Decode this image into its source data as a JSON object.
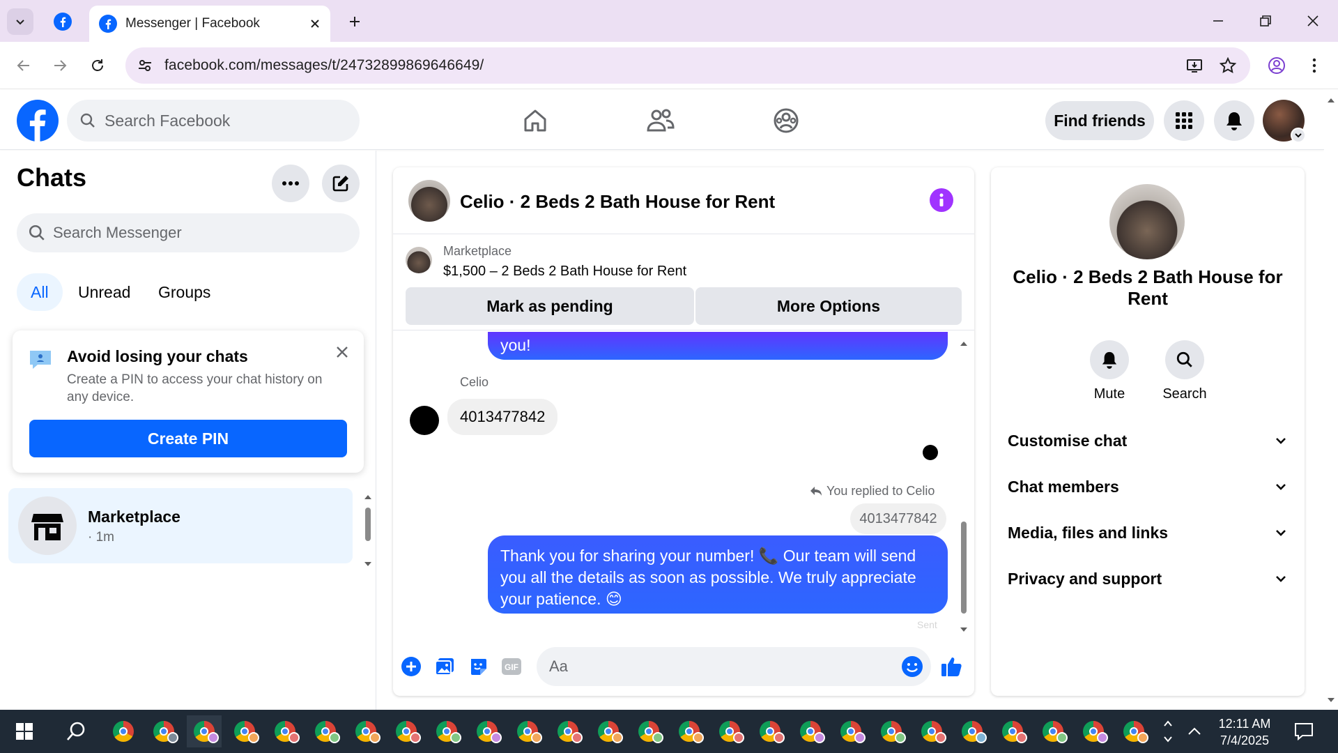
{
  "browser": {
    "tab_title": "Messenger | Facebook",
    "url": "facebook.com/messages/t/24732899869646649/"
  },
  "fb_header": {
    "search_placeholder": "Search Facebook",
    "find_friends": "Find friends"
  },
  "sidebar": {
    "title": "Chats",
    "search_placeholder": "Search Messenger",
    "filters": [
      "All",
      "Unread",
      "Groups"
    ],
    "pin_card": {
      "title": "Avoid losing your chats",
      "description": "Create a PIN to access your chat history on any device.",
      "button": "Create PIN"
    },
    "conversation": {
      "name": "Marketplace",
      "time": "· 1m"
    }
  },
  "chat": {
    "title": "Celio · 2 Beds 2 Bath House for Rent",
    "marketplace_label": "Marketplace",
    "listing": "$1,500 – 2 Beds 2 Bath House for Rent",
    "mark_pending": "Mark as pending",
    "more_options": "More Options",
    "messages": {
      "top_partial": "you!",
      "sender": "Celio",
      "incoming": "4013477842",
      "replied_to": "You replied to Celio",
      "quoted": "4013477842",
      "outgoing": "Thank you for sharing your number! 📞 Our team will send you all the details as soon as possible. We truly appreciate your patience. 😊",
      "status": "Sent"
    },
    "composer_placeholder": "Aa"
  },
  "info_panel": {
    "name": "Celio · 2 Beds 2 Bath House for Rent",
    "actions": [
      "Mute",
      "Search"
    ],
    "sections": [
      "Customise chat",
      "Chat members",
      "Media, files and links",
      "Privacy and support"
    ]
  },
  "taskbar": {
    "time": "12:11 AM",
    "date": "7/4/2025"
  },
  "colors": {
    "fb_blue": "#0866ff",
    "messenger_purple": "#a033ff"
  }
}
